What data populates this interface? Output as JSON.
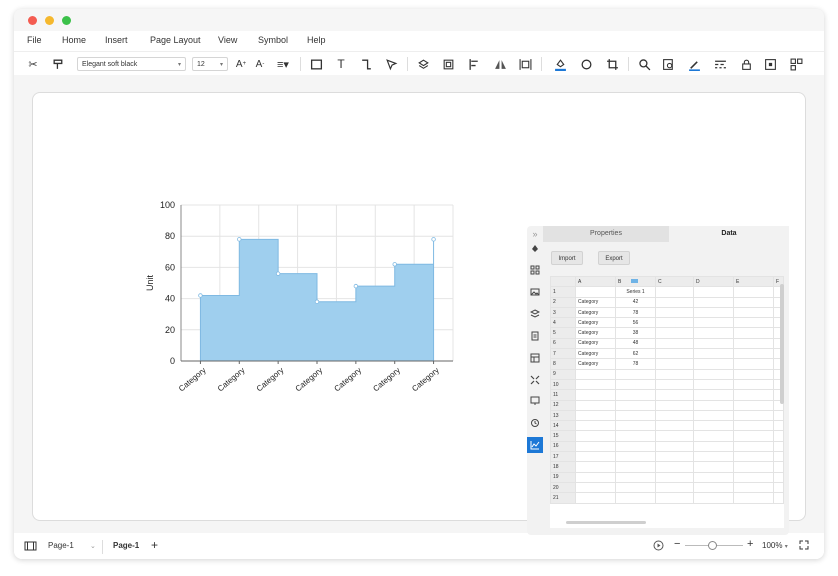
{
  "menu": [
    "File",
    "Home",
    "Insert",
    "Page Layout",
    "View",
    "Symbol",
    "Help"
  ],
  "toolbar": {
    "font_name": "Elegant soft black",
    "font_size": "12"
  },
  "chart_data": {
    "type": "area",
    "categories": [
      "Category",
      "Category",
      "Category",
      "Category",
      "Category",
      "Category",
      "Category"
    ],
    "series": [
      {
        "name": "Series 1",
        "values": [
          42,
          78,
          56,
          38,
          48,
          62,
          78
        ]
      }
    ],
    "ylabel": "Unit",
    "ylim": [
      0,
      100
    ],
    "yticks": [
      0,
      20,
      40,
      60,
      80,
      100
    ],
    "grid": true,
    "color": "#9fcfee"
  },
  "panel": {
    "tab_properties": "Properties",
    "tab_data": "Data",
    "import_label": "Import",
    "export_label": "Export",
    "columns": [
      "A",
      "B",
      "C",
      "D",
      "E",
      "F"
    ],
    "rows": [
      [
        "",
        "Series 1"
      ],
      [
        "Category",
        "42"
      ],
      [
        "Category",
        "78"
      ],
      [
        "Category",
        "56"
      ],
      [
        "Category",
        "38"
      ],
      [
        "Category",
        "48"
      ],
      [
        "Category",
        "62"
      ],
      [
        "Category",
        "78"
      ]
    ],
    "row_count": 21
  },
  "status": {
    "page_selector": "Page-1",
    "page_tab": "Page-1",
    "zoom": "100%"
  }
}
